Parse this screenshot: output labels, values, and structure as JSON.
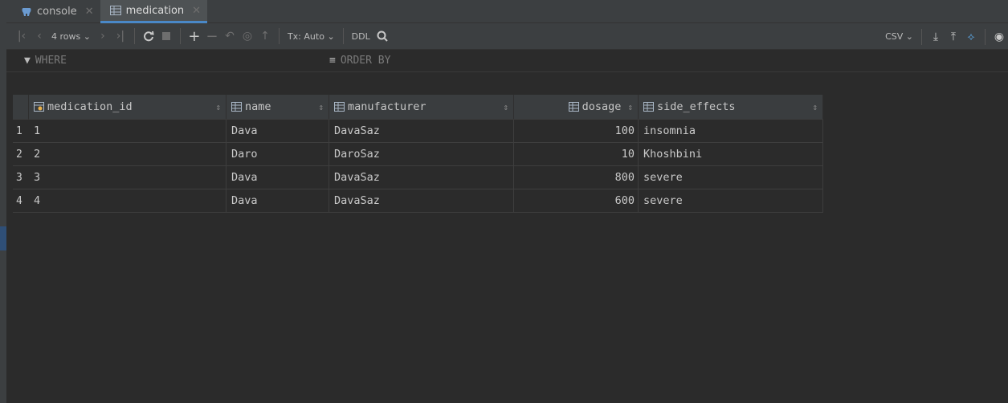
{
  "tabs": [
    {
      "label": "console",
      "icon": "postgres-elephant-icon",
      "active": false
    },
    {
      "label": "medication",
      "icon": "table-icon",
      "active": true
    }
  ],
  "toolbar": {
    "rows_label": "4 rows",
    "tx_label": "Tx: Auto",
    "ddl_label": "DDL",
    "export_format": "CSV"
  },
  "filter": {
    "where_label": "WHERE",
    "order_label": "ORDER BY"
  },
  "table": {
    "columns": [
      "medication_id",
      "name",
      "manufacturer",
      "dosage",
      "side_effects"
    ],
    "rows": [
      {
        "num": "1",
        "medication_id": "1",
        "name": "Dava",
        "manufacturer": "DavaSaz",
        "dosage": "100",
        "side_effects": "insomnia"
      },
      {
        "num": "2",
        "medication_id": "2",
        "name": "Daro",
        "manufacturer": "DaroSaz",
        "dosage": "10",
        "side_effects": "Khoshbini"
      },
      {
        "num": "3",
        "medication_id": "3",
        "name": "Dava",
        "manufacturer": "DavaSaz",
        "dosage": "800",
        "side_effects": "severe"
      },
      {
        "num": "4",
        "medication_id": "4",
        "name": "Dava",
        "manufacturer": "DavaSaz",
        "dosage": "600",
        "side_effects": "severe"
      }
    ]
  },
  "colors": {
    "background": "#2b2b2b",
    "panel": "#3c3f41",
    "accent": "#4a88c7",
    "key_icon": "#e8b04a"
  }
}
